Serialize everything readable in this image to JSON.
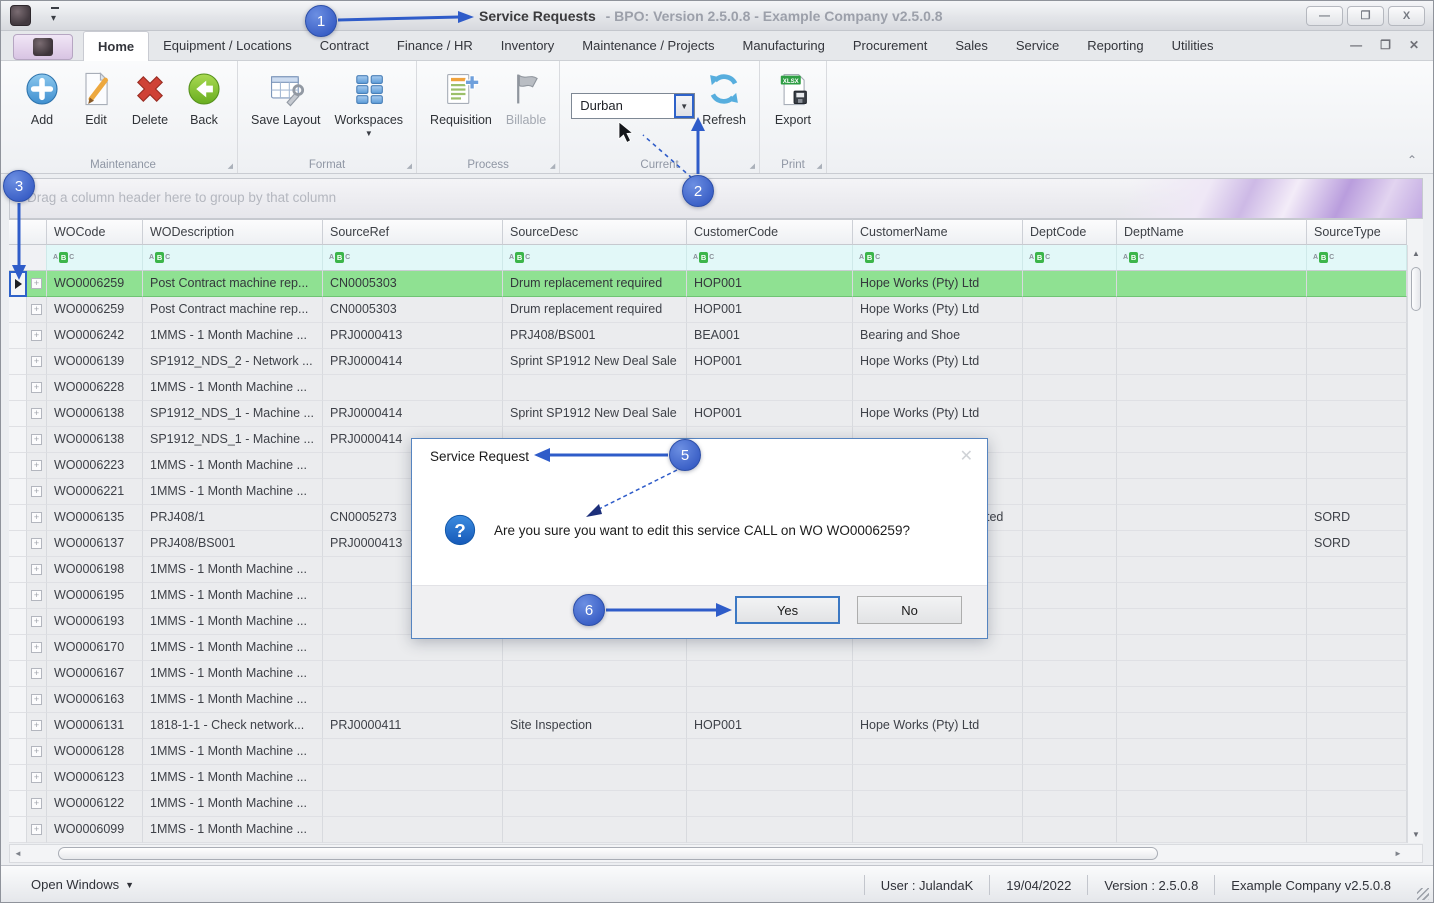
{
  "window": {
    "title_primary": "Service Requests",
    "title_secondary": "- BPO: Version 2.5.0.8 - Example Company v2.5.0.8",
    "minimize_glyph": "—",
    "maximize_glyph": "❐",
    "close_glyph": "X"
  },
  "tabs": [
    {
      "label": "Home",
      "active": true
    },
    {
      "label": "Equipment / Locations"
    },
    {
      "label": "Contract"
    },
    {
      "label": "Finance / HR"
    },
    {
      "label": "Inventory"
    },
    {
      "label": "Maintenance / Projects"
    },
    {
      "label": "Manufacturing"
    },
    {
      "label": "Procurement"
    },
    {
      "label": "Sales"
    },
    {
      "label": "Service"
    },
    {
      "label": "Reporting"
    },
    {
      "label": "Utilities"
    }
  ],
  "ribbon": {
    "groups": [
      {
        "label": "Maintenance",
        "items": [
          {
            "type": "button",
            "label": "Add",
            "icon": "add-icon"
          },
          {
            "type": "button",
            "label": "Edit",
            "icon": "edit-icon"
          },
          {
            "type": "button",
            "label": "Delete",
            "icon": "delete-icon"
          },
          {
            "type": "button",
            "label": "Back",
            "icon": "back-icon"
          }
        ]
      },
      {
        "label": "Format",
        "items": [
          {
            "type": "button",
            "label": "Save Layout",
            "icon": "save-layout-icon"
          },
          {
            "type": "button",
            "label": "Workspaces",
            "icon": "workspaces-icon",
            "dropdown": true
          }
        ]
      },
      {
        "label": "Process",
        "items": [
          {
            "type": "button",
            "label": "Requisition",
            "icon": "requisition-icon"
          },
          {
            "type": "button",
            "label": "Billable",
            "icon": "billable-icon",
            "disabled": true
          }
        ]
      },
      {
        "label": "Current",
        "items": [
          {
            "type": "combo",
            "value": "Durban"
          },
          {
            "type": "button",
            "label": "Refresh",
            "icon": "refresh-icon"
          }
        ]
      },
      {
        "label": "Print",
        "items": [
          {
            "type": "button",
            "label": "Export",
            "icon": "export-icon"
          }
        ]
      }
    ]
  },
  "group_band_hint": "Drag a column header here to group by that column",
  "grid": {
    "columns": [
      "WOCode",
      "WODescription",
      "SourceRef",
      "SourceDesc",
      "CustomerCode",
      "CustomerName",
      "DeptCode",
      "DeptName",
      "SourceType"
    ],
    "rows": [
      {
        "selected": true,
        "cells": [
          "WO0006259",
          "Post Contract machine rep...",
          "CN0005303",
          "Drum replacement required",
          "HOP001",
          "Hope Works (Pty) Ltd",
          "",
          "",
          ""
        ]
      },
      {
        "cells": [
          "WO0006259",
          "Post Contract machine rep...",
          "CN0005303",
          "Drum replacement required",
          "HOP001",
          "Hope Works (Pty) Ltd",
          "",
          "",
          ""
        ]
      },
      {
        "cells": [
          "WO0006242",
          "1MMS - 1 Month Machine ...",
          "PRJ0000413",
          "PRJ408/BS001",
          "BEA001",
          "Bearing and Shoe",
          "",
          "",
          ""
        ]
      },
      {
        "cells": [
          "WO0006139",
          "SP1912_NDS_2 - Network ...",
          "PRJ0000414",
          "Sprint SP1912 New Deal Sale",
          "HOP001",
          "Hope Works (Pty) Ltd",
          "",
          "",
          ""
        ]
      },
      {
        "cells": [
          "WO0006228",
          "1MMS - 1 Month Machine ...",
          "",
          "",
          "",
          "",
          "",
          "",
          ""
        ]
      },
      {
        "cells": [
          "WO0006138",
          "SP1912_NDS_1 - Machine ...",
          "PRJ0000414",
          "Sprint SP1912 New Deal Sale",
          "HOP001",
          "Hope Works (Pty) Ltd",
          "",
          "",
          ""
        ]
      },
      {
        "cells": [
          "WO0006138",
          "SP1912_NDS_1 - Machine ...",
          "PRJ0000414",
          "",
          "",
          "",
          "",
          "",
          ""
        ]
      },
      {
        "cells": [
          "WO0006223",
          "1MMS - 1 Month Machine ...",
          "",
          "",
          "",
          "",
          "",
          "",
          ""
        ]
      },
      {
        "cells": [
          "WO0006221",
          "1MMS - 1 Month Machine ...",
          "",
          "",
          "",
          "",
          "",
          "",
          ""
        ]
      },
      {
        "cells": [
          "WO0006135",
          "PRJ408/1",
          "CN0005273",
          "",
          "",
          "ted",
          "",
          "",
          "SORD"
        ],
        "cell_pad": {
          "5": 126
        }
      },
      {
        "cells": [
          "WO0006137",
          "PRJ408/BS001",
          "PRJ0000413",
          "",
          "",
          "",
          "",
          "",
          "SORD"
        ]
      },
      {
        "cells": [
          "WO0006198",
          "1MMS - 1 Month Machine ...",
          "",
          "",
          "",
          "",
          "",
          "",
          ""
        ]
      },
      {
        "cells": [
          "WO0006195",
          "1MMS - 1 Month Machine ...",
          "",
          "",
          "",
          "",
          "",
          "",
          ""
        ]
      },
      {
        "cells": [
          "WO0006193",
          "1MMS - 1 Month Machine ...",
          "",
          "",
          "",
          "",
          "",
          "",
          ""
        ]
      },
      {
        "cells": [
          "WO0006170",
          "1MMS - 1 Month Machine ...",
          "",
          "",
          "",
          "",
          "",
          "",
          ""
        ]
      },
      {
        "cells": [
          "WO0006167",
          "1MMS - 1 Month Machine ...",
          "",
          "",
          "",
          "",
          "",
          "",
          ""
        ]
      },
      {
        "cells": [
          "WO0006163",
          "1MMS - 1 Month Machine ...",
          "",
          "",
          "",
          "",
          "",
          "",
          ""
        ]
      },
      {
        "cells": [
          "WO0006131",
          "1818-1-1 - Check network...",
          "PRJ0000411",
          "Site Inspection",
          "HOP001",
          "Hope Works (Pty) Ltd",
          "",
          "",
          ""
        ]
      },
      {
        "cells": [
          "WO0006128",
          "1MMS - 1 Month Machine ...",
          "",
          "",
          "",
          "",
          "",
          "",
          ""
        ]
      },
      {
        "cells": [
          "WO0006123",
          "1MMS - 1 Month Machine ...",
          "",
          "",
          "",
          "",
          "",
          "",
          ""
        ]
      },
      {
        "cells": [
          "WO0006122",
          "1MMS - 1 Month Machine ...",
          "",
          "",
          "",
          "",
          "",
          "",
          ""
        ]
      },
      {
        "cells": [
          "WO0006099",
          "1MMS - 1 Month Machine ...",
          "",
          "",
          "",
          "",
          "",
          "",
          ""
        ]
      }
    ]
  },
  "dialog": {
    "title": "Service Request",
    "message": "Are you sure you want to edit this service CALL on WO WO0006259?",
    "yes_label": "Yes",
    "no_label": "No"
  },
  "statusbar": {
    "open_windows": "Open Windows",
    "user": "User : JulandaK",
    "date": "19/04/2022",
    "version": "Version : 2.5.0.8",
    "company": "Example Company v2.5.0.8"
  },
  "annotations": [
    {
      "n": "1",
      "target": "window-title"
    },
    {
      "n": "2",
      "target": "branch-combo-dropdown-button"
    },
    {
      "n": "3",
      "target": "row-selector"
    },
    {
      "n": "5",
      "target": "dialog-title"
    },
    {
      "n": "6",
      "target": "yes-button"
    }
  ],
  "colors": {
    "accent_blue": "#2f5cc9",
    "selected_row_green": "#8fe192",
    "filter_row_cyan": "#e2f8f8",
    "abc_green": "#3cb54a"
  }
}
